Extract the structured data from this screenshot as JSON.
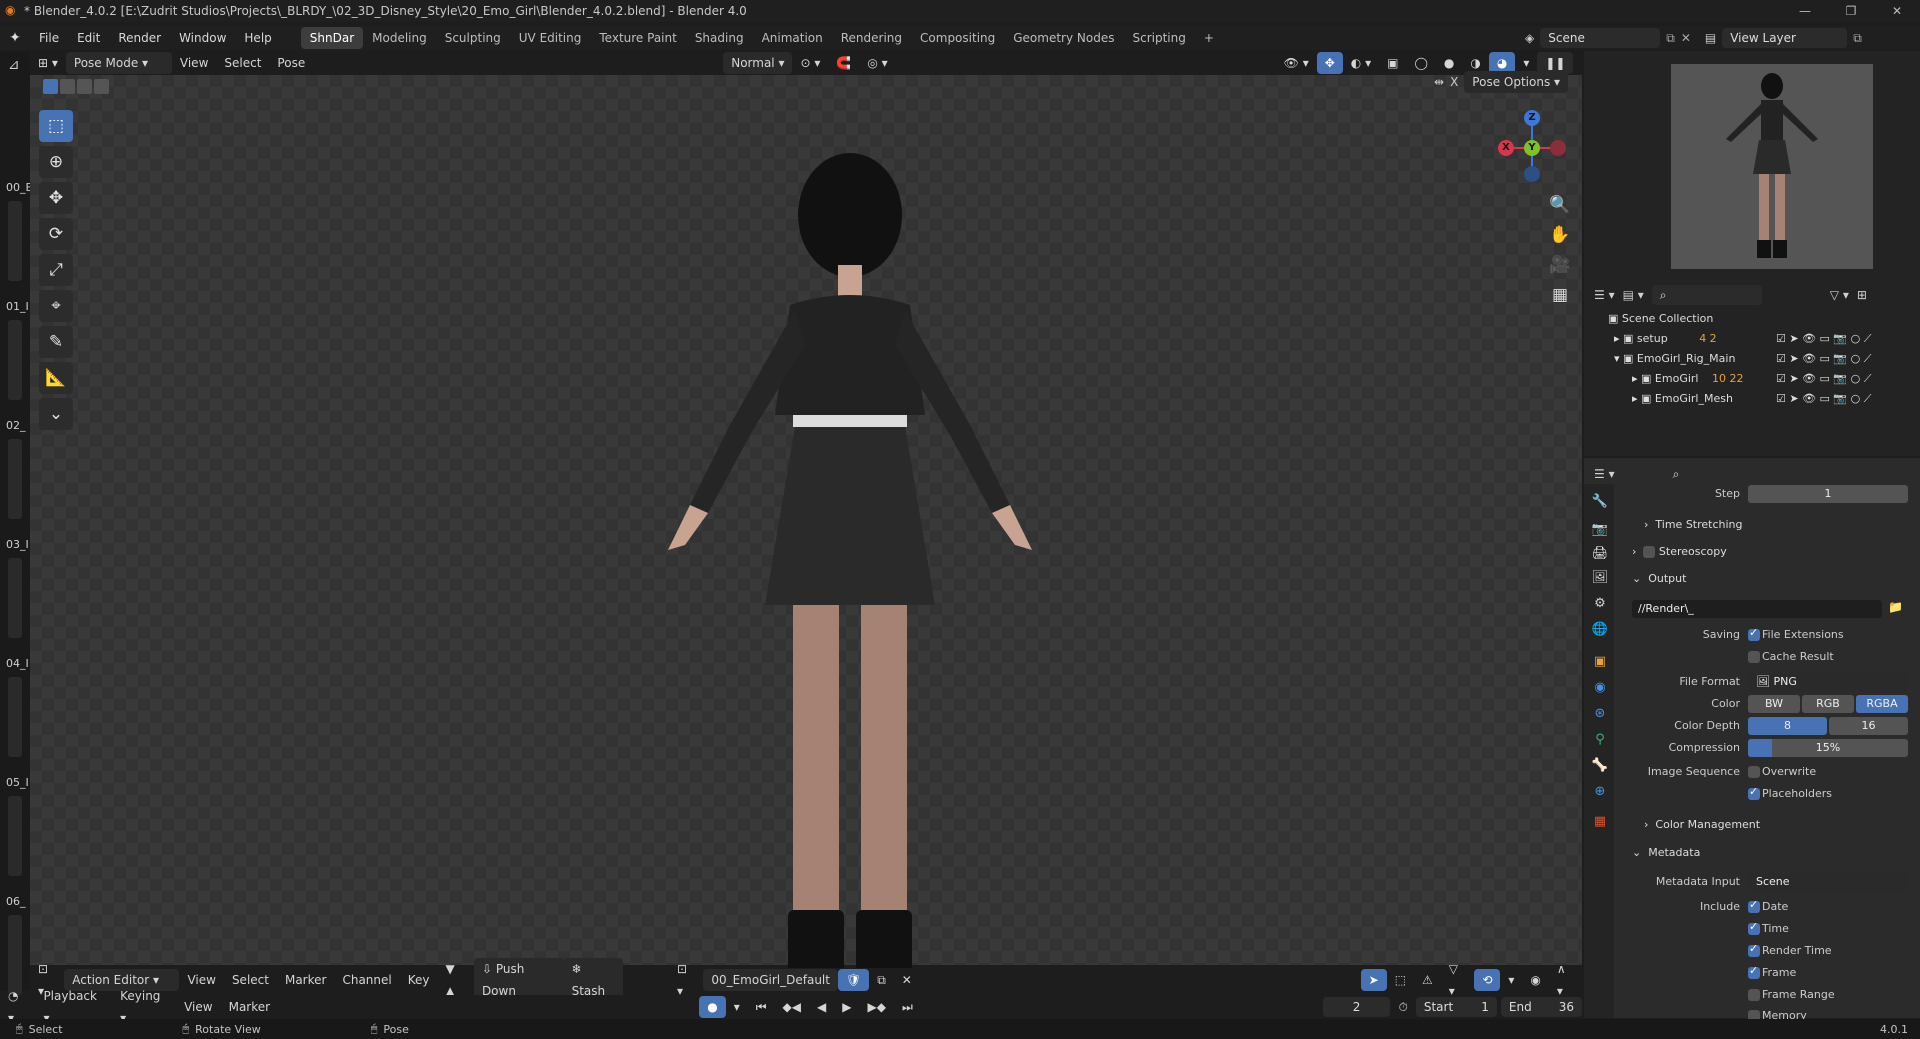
{
  "window": {
    "title": "* Blender_4.0.2 [E:\\Zudrit Studios\\Projects\\_BLRDY_\\02_3D_Disney_Style\\20_Emo_Girl\\Blender_4.0.2.blend] - Blender 4.0",
    "controls": [
      "—",
      "❐",
      "✕"
    ]
  },
  "menu": [
    "File",
    "Edit",
    "Render",
    "Window",
    "Help"
  ],
  "workspaces": [
    {
      "label": "ShnDar",
      "active": true
    },
    {
      "label": "Modeling"
    },
    {
      "label": "Sculpting"
    },
    {
      "label": "UV Editing"
    },
    {
      "label": "Texture Paint"
    },
    {
      "label": "Shading"
    },
    {
      "label": "Animation"
    },
    {
      "label": "Rendering"
    },
    {
      "label": "Compositing"
    },
    {
      "label": "Geometry Nodes"
    },
    {
      "label": "Scripting"
    },
    {
      "label": "+"
    }
  ],
  "scene": {
    "name": "Scene",
    "view_layer": "View Layer"
  },
  "viewport_header": {
    "mode": "Pose Mode",
    "menus": [
      "View",
      "Select",
      "Pose"
    ],
    "orientation": "Normal",
    "pose_options": "Pose Options"
  },
  "left_strip_labels": [
    "00_E",
    "01_I",
    "02_",
    "03_I",
    "04_I",
    "05_I",
    "06_"
  ],
  "gizmo": {
    "z": "Z",
    "y": "Y",
    "x": "X"
  },
  "outliner": {
    "root": "Scene Collection",
    "items": [
      {
        "label": "setup",
        "badge": "4 2",
        "indent": 1,
        "expanded": false
      },
      {
        "label": "EmoGirl_Rig_Main",
        "badge": "",
        "indent": 1,
        "expanded": true
      },
      {
        "label": "EmoGirl",
        "badge": "10 22",
        "indent": 2,
        "expanded": false
      },
      {
        "label": "EmoGirl_Mesh",
        "badge": "",
        "indent": 2,
        "expanded": false
      }
    ]
  },
  "properties": {
    "step_label": "Step",
    "step_value": "1",
    "time_stretching": "Time Stretching",
    "stereoscopy": "Stereoscopy",
    "output": "Output",
    "output_path": "//Render\\_",
    "saving_label": "Saving",
    "file_extensions": "File Extensions",
    "cache_result": "Cache Result",
    "file_format_label": "File Format",
    "file_format": "PNG",
    "color_label": "Color",
    "color_options": [
      "BW",
      "RGB",
      "RGBA"
    ],
    "color_selected": "RGBA",
    "color_depth_label": "Color Depth",
    "color_depth_options": [
      "8",
      "16"
    ],
    "color_depth_selected": "8",
    "compression_label": "Compression",
    "compression_value": "15%",
    "compression_fraction": 0.15,
    "image_sequence_label": "Image Sequence",
    "overwrite": "Overwrite",
    "placeholders": "Placeholders",
    "color_management": "Color Management",
    "metadata": "Metadata",
    "metadata_input_label": "Metadata Input",
    "metadata_input": "Scene",
    "include_label": "Include",
    "include_items": [
      {
        "label": "Date",
        "checked": true
      },
      {
        "label": "Time",
        "checked": true
      },
      {
        "label": "Render Time",
        "checked": true
      },
      {
        "label": "Frame",
        "checked": true
      },
      {
        "label": "Frame Range",
        "checked": false
      },
      {
        "label": "Memory",
        "checked": false
      }
    ]
  },
  "action_editor": {
    "mode": "Action Editor",
    "menus": [
      "View",
      "Select",
      "Marker",
      "Channel",
      "Key"
    ],
    "push_down": "Push Down",
    "stash": "Stash",
    "action_name": "00_EmoGirl_Default"
  },
  "timeline": {
    "menus": [
      "Playback",
      "Keying",
      "View",
      "Marker"
    ],
    "current_frame": "2",
    "start_label": "Start",
    "start": "1",
    "end_label": "End",
    "end": "36"
  },
  "status": {
    "select": "Select",
    "rotate": "Rotate View",
    "pose": "Pose",
    "version": "4.0.1"
  }
}
